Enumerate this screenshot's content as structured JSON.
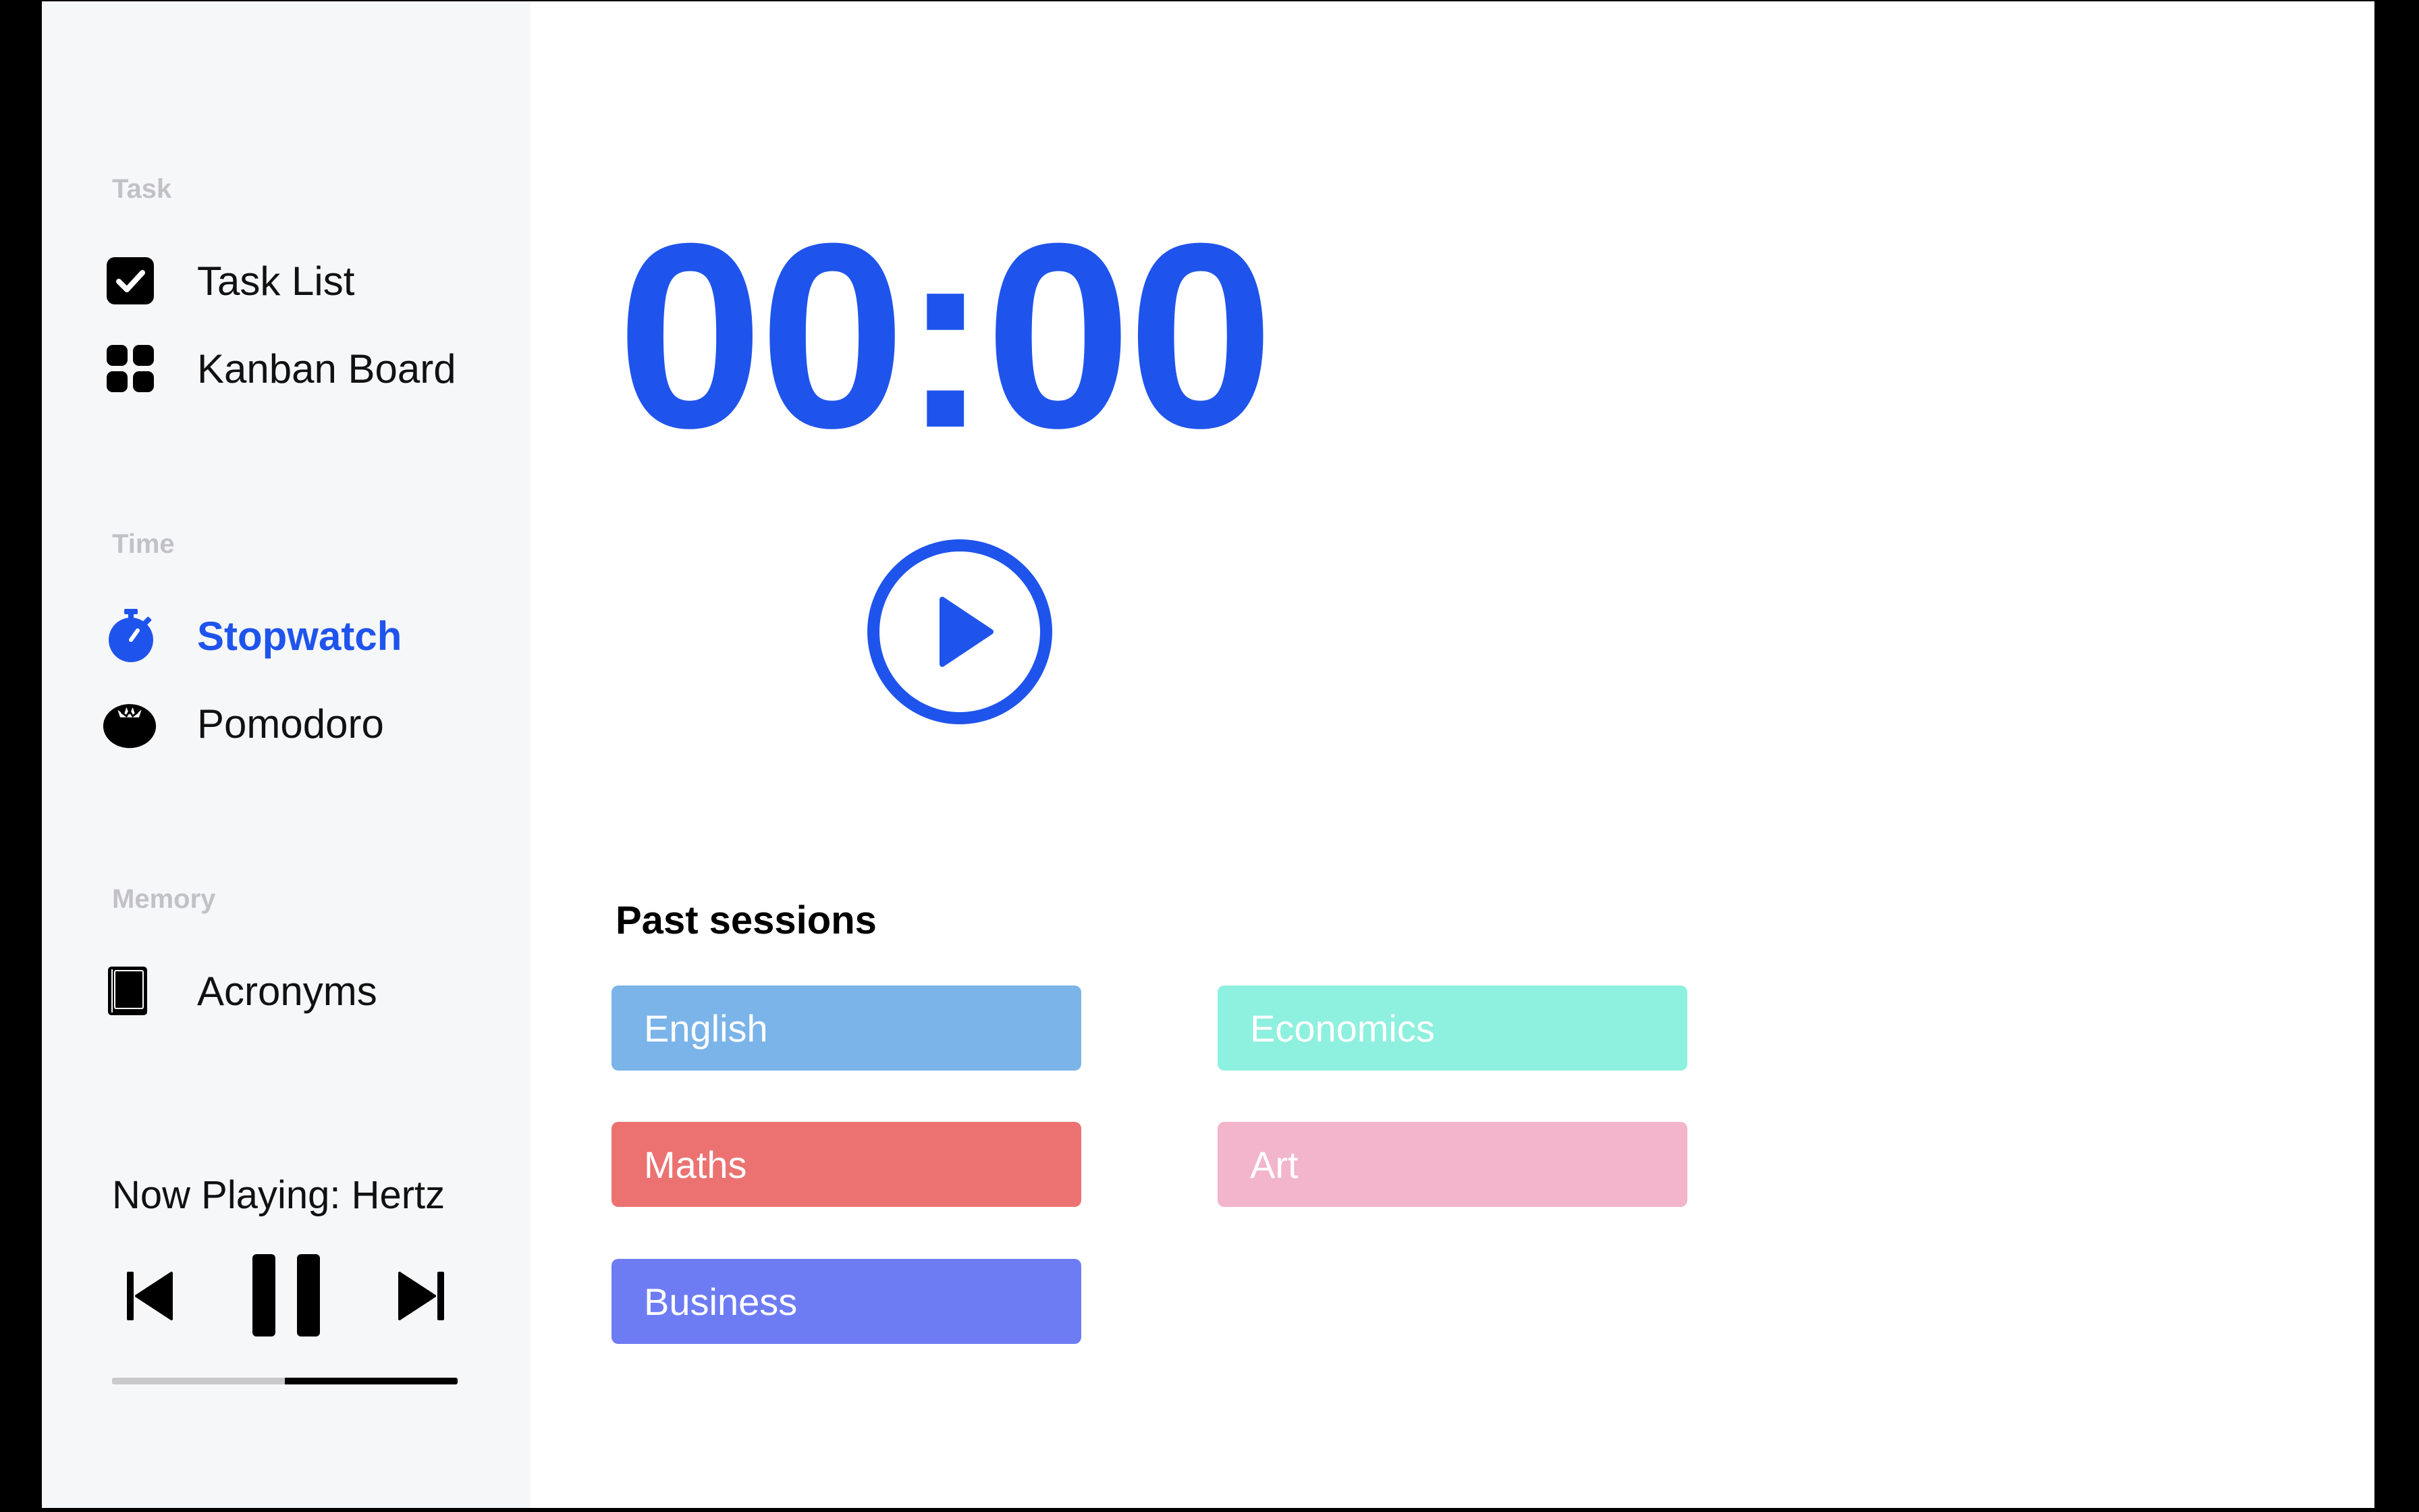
{
  "sidebar": {
    "sections": {
      "task": "Task",
      "time": "Time",
      "memory": "Memory"
    },
    "items": {
      "task_list": "Task List",
      "kanban": "Kanban Board",
      "stopwatch": "Stopwatch",
      "pomodoro": "Pomodoro",
      "acronyms": "Acronyms"
    },
    "active_item": "stopwatch",
    "icons": [
      "checkbox-icon",
      "grid-icon",
      "stopwatch-icon",
      "tomato-icon",
      "book-icon"
    ]
  },
  "player": {
    "now_playing": "Now Playing: Hertz",
    "progress": 0.5,
    "icons": [
      "previous-icon",
      "pause-icon",
      "next-icon"
    ]
  },
  "main": {
    "timer": "00:00",
    "play_icon": "play-icon",
    "sessions_title": "Past sessions",
    "sessions": [
      {
        "label": "English",
        "color": "#7bb4e9"
      },
      {
        "label": "Economics",
        "color": "#8ef0de"
      },
      {
        "label": "Maths",
        "color": "#ec7272"
      },
      {
        "label": "Art",
        "color": "#f2b5cb"
      },
      {
        "label": "Business",
        "color": "#6e7cf4"
      }
    ]
  },
  "colors": {
    "accent": "#1f54ec",
    "sidebar_bg": "#f6f7f9",
    "section_label": "#c2c2c6"
  }
}
